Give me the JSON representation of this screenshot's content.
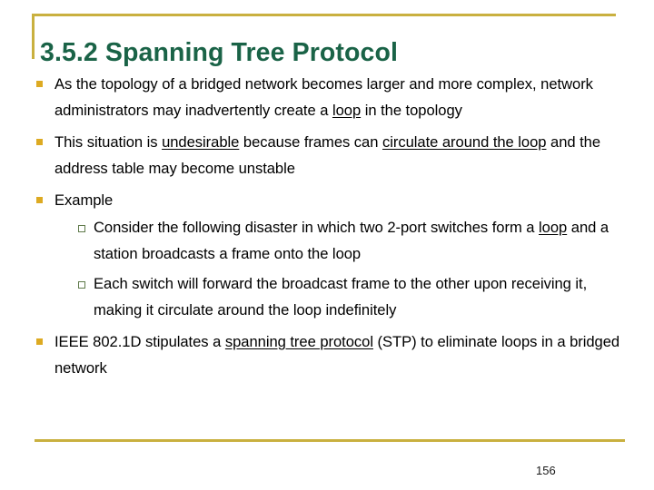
{
  "slide": {
    "title": "3.5.2 Spanning Tree Protocol",
    "page_number": "156",
    "colors": {
      "title_green": "#1a6347",
      "rule_gold": "#c9b03f",
      "bullet_gold": "#ddaa22",
      "sub_bullet_olive": "#5f7a4a",
      "body_text": "#000000",
      "background": "#ffffff"
    },
    "markers": {
      "level1_icon": "filled-square-bullet-icon",
      "level2_icon": "hollow-square-bullet-icon"
    },
    "bullets": [
      {
        "level": 1,
        "segments": [
          {
            "text": "As the topology of a bridged network becomes larger and more complex, network administrators may inadvertently create a ",
            "underline": false
          },
          {
            "text": "loop",
            "underline": true
          },
          {
            "text": " in the topology",
            "underline": false
          }
        ],
        "plain": "As the topology of a bridged network becomes larger and more complex, network administrators may inadvertently create a loop in the topology"
      },
      {
        "level": 1,
        "segments": [
          {
            "text": "This situation is ",
            "underline": false
          },
          {
            "text": "undesirable",
            "underline": true
          },
          {
            "text": " because frames can ",
            "underline": false
          },
          {
            "text": "circulate around the loop",
            "underline": true
          },
          {
            "text": " and the address table may become unstable",
            "underline": false
          }
        ],
        "plain": "This situation is undesirable because frames can circulate around the loop and the address table may become unstable"
      },
      {
        "level": 1,
        "segments": [
          {
            "text": "Example",
            "underline": false
          }
        ],
        "plain": "Example"
      },
      {
        "level": 2,
        "segments": [
          {
            "text": "Consider the following disaster in which two 2-port switches form a ",
            "underline": false
          },
          {
            "text": "loop",
            "underline": true
          },
          {
            "text": " and a station broadcasts a frame onto the loop",
            "underline": false
          }
        ],
        "plain": "Consider the following disaster in which two 2-port switches form a loop and a station broadcasts a frame onto the loop"
      },
      {
        "level": 2,
        "segments": [
          {
            "text": "Each switch will forward the broadcast frame to the other upon receiving it, making it circulate around the loop indefinitely",
            "underline": false
          }
        ],
        "plain": "Each switch will forward the broadcast frame to the other upon receiving it, making it circulate around the loop indefinitely"
      },
      {
        "level": 1,
        "segments": [
          {
            "text": "IEEE 802.1D stipulates a ",
            "underline": false
          },
          {
            "text": "spanning tree protocol",
            "underline": true
          },
          {
            "text": " (STP) to eliminate loops in a bridged network",
            "underline": false
          }
        ],
        "plain": "IEEE 802.1D stipulates a spanning tree protocol (STP) to eliminate loops in a bridged network"
      }
    ]
  }
}
